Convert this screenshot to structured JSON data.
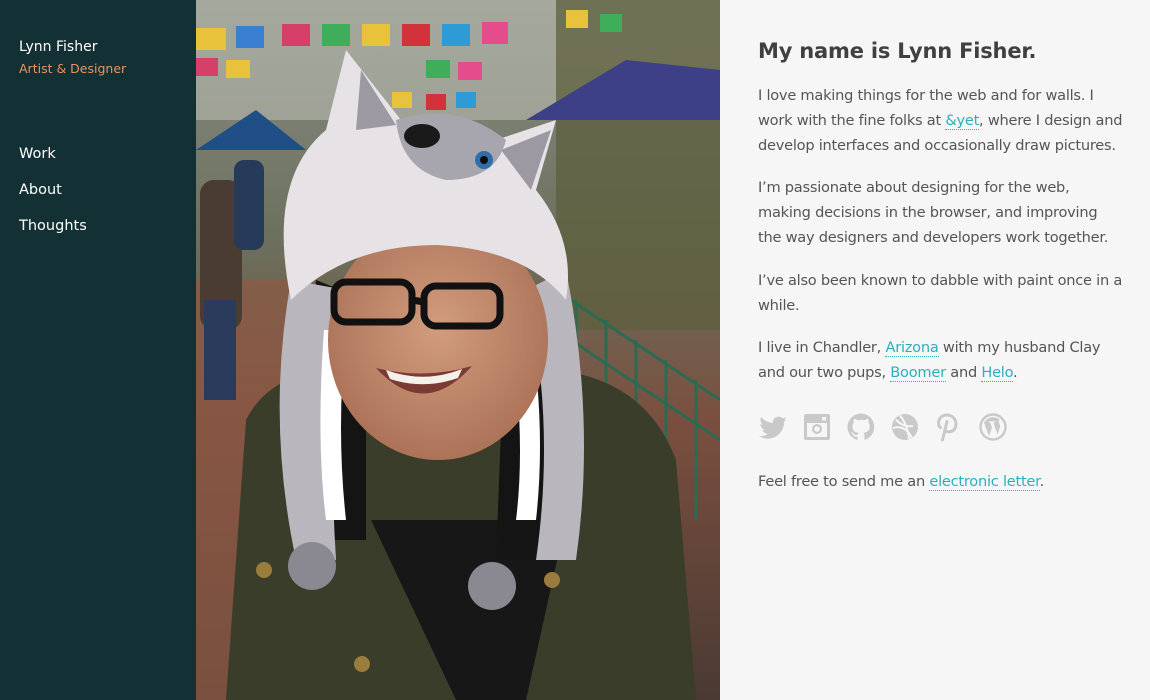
{
  "sidebar": {
    "name": "Lynn Fisher",
    "subtitle": "Artist & Designer",
    "nav": [
      {
        "label": "Work"
      },
      {
        "label": "About"
      },
      {
        "label": "Thoughts"
      }
    ]
  },
  "photo": {
    "alt": "Photo of Lynn Fisher wearing a husky hat"
  },
  "content": {
    "heading": "My name is Lynn Fisher.",
    "p1": {
      "before": "I love making things for the web and for walls. I work with the fine folks at ",
      "link": "&yet",
      "after": ", where I design and develop interfaces and occasionally draw pictures."
    },
    "p2": "I’m passionate about designing for the web, making decisions in the browser, and improving the way designers and developers work together.",
    "p3": "I’ve also been known to dabble with paint once in a while.",
    "p4": {
      "t1": "I live in Chandler, ",
      "link1": "Arizona",
      "t2": " with my husband Clay and our two pups, ",
      "link2": "Boomer",
      "t3": " and ",
      "link3": "Helo",
      "t4": "."
    },
    "social": [
      {
        "icon": "twitter-icon"
      },
      {
        "icon": "instagram-icon"
      },
      {
        "icon": "github-icon"
      },
      {
        "icon": "dribbble-icon"
      },
      {
        "icon": "pinterest-icon"
      },
      {
        "icon": "wordpress-icon"
      }
    ],
    "contact": {
      "before": "Feel free to send me an ",
      "link": "electronic letter",
      "after": "."
    }
  },
  "colors": {
    "sidebar_bg": "#133135",
    "accent_orange": "#e8945f",
    "link_teal": "#2ab0bd",
    "content_bg": "#f6f6f6"
  }
}
